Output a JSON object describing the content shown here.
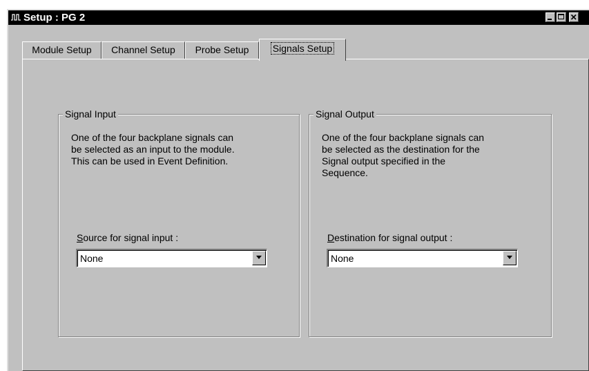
{
  "window": {
    "title": "Setup : PG 2"
  },
  "tabs": [
    {
      "label": "Module Setup",
      "active": false
    },
    {
      "label": "Channel Setup",
      "active": false
    },
    {
      "label": "Probe Setup",
      "active": false
    },
    {
      "label": "Signals Setup",
      "active": true
    }
  ],
  "signal_input": {
    "group_title": "Signal Input",
    "description_lines": [
      "One of the four backplane signals can",
      "be selected as an input to the module.",
      "This can be used in Event Definition."
    ],
    "label_mnemonic": "S",
    "label_rest": "ource for signal input :",
    "selected": "None"
  },
  "signal_output": {
    "group_title": "Signal Output",
    "description_lines": [
      "One of the four backplane signals can",
      "be selected as the destination for the",
      "Signal output specified in the",
      "Sequence."
    ],
    "label_mnemonic": "D",
    "label_rest": "estination for signal output :",
    "selected": "None"
  },
  "icons": {
    "app": "signal-waveform-icon",
    "minimize": "minimize-icon",
    "maximize": "maximize-icon",
    "close": "close-icon",
    "dropdown": "dropdown-arrow-icon"
  }
}
